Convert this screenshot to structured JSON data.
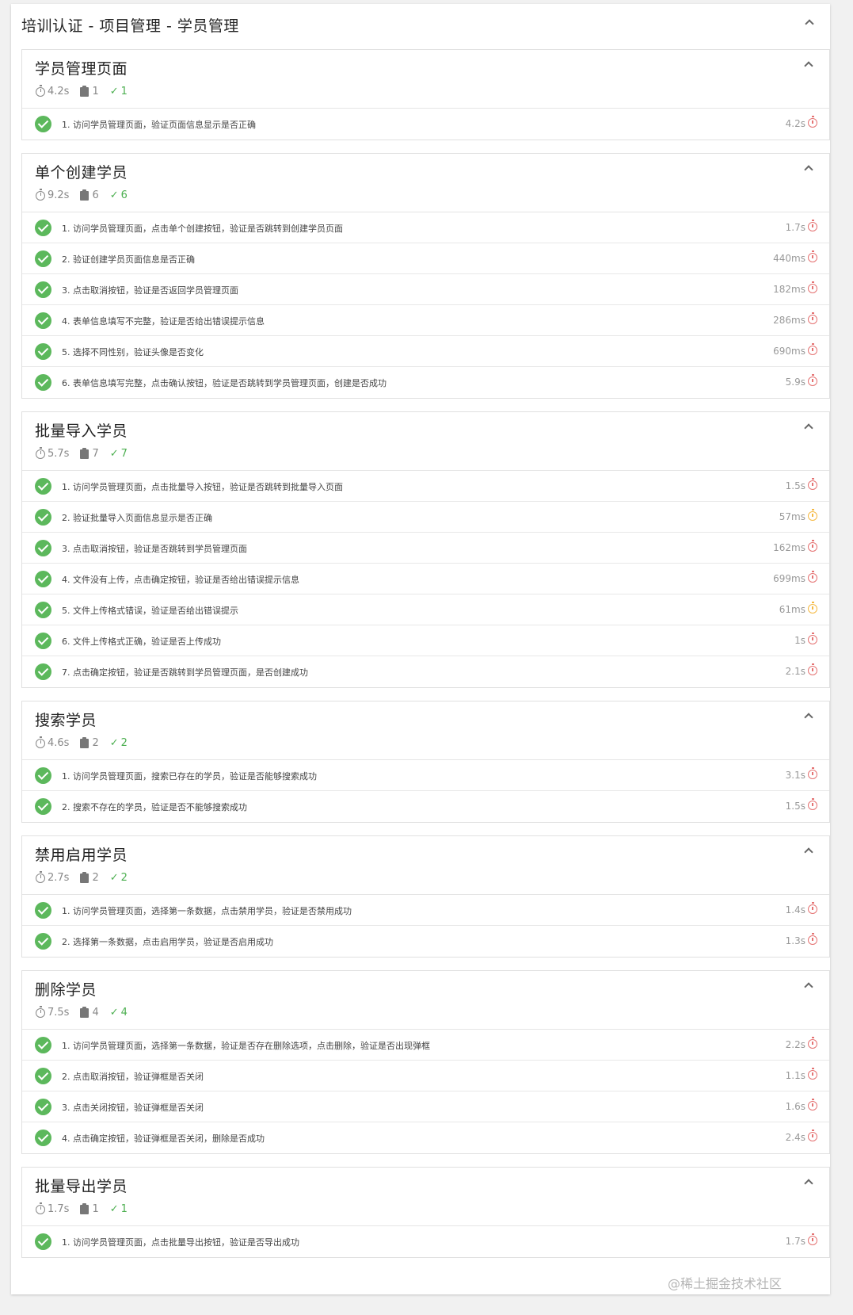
{
  "header": {
    "title": "培训认证 - 项目管理 - 学员管理"
  },
  "watermark": "@稀土掘金技术社区",
  "suites": [
    {
      "title": "学员管理页面",
      "duration": "4.2s",
      "total": "1",
      "passed": "1",
      "tests": [
        {
          "name": "1. 访问学员管理页面，验证页面信息显示是否正确",
          "duration": "4.2s",
          "speed": "slow"
        }
      ]
    },
    {
      "title": "单个创建学员",
      "duration": "9.2s",
      "total": "6",
      "passed": "6",
      "tests": [
        {
          "name": "1. 访问学员管理页面，点击单个创建按钮，验证是否跳转到创建学员页面",
          "duration": "1.7s",
          "speed": "slow"
        },
        {
          "name": "2. 验证创建学员页面信息是否正确",
          "duration": "440ms",
          "speed": "slow"
        },
        {
          "name": "3. 点击取消按钮，验证是否返回学员管理页面",
          "duration": "182ms",
          "speed": "slow"
        },
        {
          "name": "4. 表单信息填写不完整，验证是否给出错误提示信息",
          "duration": "286ms",
          "speed": "slow"
        },
        {
          "name": "5. 选择不同性别，验证头像是否变化",
          "duration": "690ms",
          "speed": "slow"
        },
        {
          "name": "6. 表单信息填写完整，点击确认按钮，验证是否跳转到学员管理页面，创建是否成功",
          "duration": "5.9s",
          "speed": "slow"
        }
      ]
    },
    {
      "title": "批量导入学员",
      "duration": "5.7s",
      "total": "7",
      "passed": "7",
      "tests": [
        {
          "name": "1. 访问学员管理页面，点击批量导入按钮，验证是否跳转到批量导入页面",
          "duration": "1.5s",
          "speed": "slow"
        },
        {
          "name": "2. 验证批量导入页面信息显示是否正确",
          "duration": "57ms",
          "speed": "fast"
        },
        {
          "name": "3. 点击取消按钮，验证是否跳转到学员管理页面",
          "duration": "162ms",
          "speed": "slow"
        },
        {
          "name": "4. 文件没有上传，点击确定按钮，验证是否给出错误提示信息",
          "duration": "699ms",
          "speed": "slow"
        },
        {
          "name": "5. 文件上传格式错误，验证是否给出错误提示",
          "duration": "61ms",
          "speed": "fast"
        },
        {
          "name": "6. 文件上传格式正确，验证是否上传成功",
          "duration": "1s",
          "speed": "slow"
        },
        {
          "name": "7. 点击确定按钮，验证是否跳转到学员管理页面，是否创建成功",
          "duration": "2.1s",
          "speed": "slow"
        }
      ]
    },
    {
      "title": "搜索学员",
      "duration": "4.6s",
      "total": "2",
      "passed": "2",
      "tests": [
        {
          "name": "1. 访问学员管理页面，搜索已存在的学员，验证是否能够搜索成功",
          "duration": "3.1s",
          "speed": "slow"
        },
        {
          "name": "2. 搜索不存在的学员，验证是否不能够搜索成功",
          "duration": "1.5s",
          "speed": "slow"
        }
      ]
    },
    {
      "title": "禁用启用学员",
      "duration": "2.7s",
      "total": "2",
      "passed": "2",
      "tests": [
        {
          "name": "1. 访问学员管理页面，选择第一条数据，点击禁用学员，验证是否禁用成功",
          "duration": "1.4s",
          "speed": "slow"
        },
        {
          "name": "2. 选择第一条数据，点击启用学员，验证是否启用成功",
          "duration": "1.3s",
          "speed": "slow"
        }
      ]
    },
    {
      "title": "删除学员",
      "duration": "7.5s",
      "total": "4",
      "passed": "4",
      "tests": [
        {
          "name": "1. 访问学员管理页面，选择第一条数据，验证是否存在删除选项，点击删除，验证是否出现弹框",
          "duration": "2.2s",
          "speed": "slow"
        },
        {
          "name": "2. 点击取消按钮，验证弹框是否关闭",
          "duration": "1.1s",
          "speed": "slow"
        },
        {
          "name": "3. 点击关闭按钮，验证弹框是否关闭",
          "duration": "1.6s",
          "speed": "slow"
        },
        {
          "name": "4. 点击确定按钮，验证弹框是否关闭，删除是否成功",
          "duration": "2.4s",
          "speed": "slow"
        }
      ]
    },
    {
      "title": "批量导出学员",
      "duration": "1.7s",
      "total": "1",
      "passed": "1",
      "tests": [
        {
          "name": "1. 访问学员管理页面，点击批量导出按钮，验证是否导出成功",
          "duration": "1.7s",
          "speed": "slow"
        }
      ]
    }
  ]
}
